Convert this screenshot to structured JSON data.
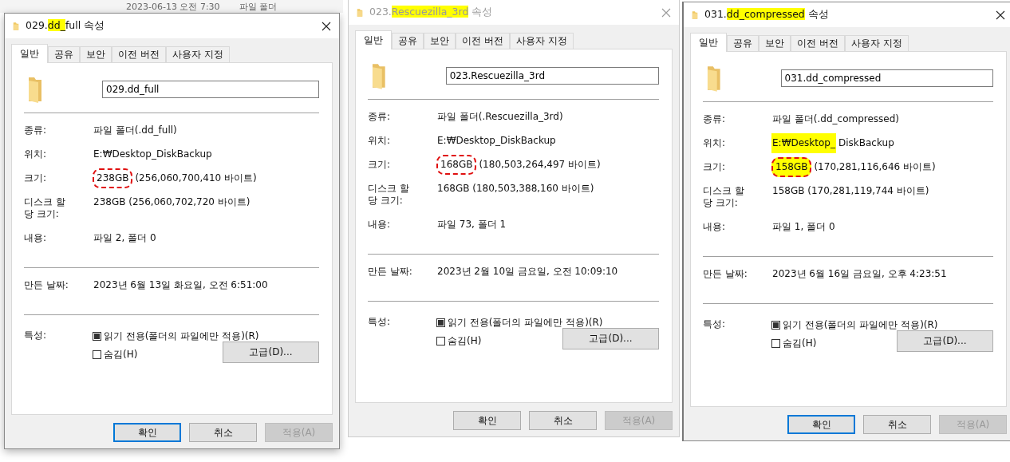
{
  "background": {
    "texts": [
      "2023-06-13 오전 7:30",
      "파일 폴더"
    ]
  },
  "dialogs": [
    {
      "active": true,
      "title_parts": [
        {
          "text": "029.",
          "highlight": false
        },
        {
          "text": "dd_",
          "highlight": true
        },
        {
          "text": "full 속성",
          "highlight": false
        }
      ],
      "tabs": [
        {
          "label": "일반",
          "selected": true
        },
        {
          "label": "공유",
          "selected": false
        },
        {
          "label": "보안",
          "selected": false
        },
        {
          "label": "이전 버전",
          "selected": false
        },
        {
          "label": "사용자 지정",
          "selected": false
        }
      ],
      "name": "029.dd_full",
      "sections": [
        [
          {
            "label": "종류:",
            "parts": [
              {
                "text": "파일 폴더(.dd_full)",
                "highlight": false,
                "circled": false
              }
            ]
          },
          {
            "label": "위치:",
            "parts": [
              {
                "text": "E:₩Desktop_DiskBackup",
                "highlight": false,
                "circled": false
              }
            ]
          },
          {
            "label": "크기:",
            "parts": [
              {
                "text": "238GB",
                "highlight": false,
                "circled": true
              },
              {
                "text": "(256,060,700,410 바이트)",
                "highlight": false,
                "circled": false
              }
            ]
          },
          {
            "label": "디스크 할당 크기:",
            "parts": [
              {
                "text": "238GB (256,060,702,720 바이트)",
                "highlight": false,
                "circled": false
              }
            ]
          },
          {
            "label": "내용:",
            "parts": [
              {
                "text": "파일 2, 폴더 0",
                "highlight": false,
                "circled": false
              }
            ]
          }
        ],
        [
          {
            "label": "만든 날짜:",
            "parts": [
              {
                "text": "2023년 6월 13일 화요일, 오전 6:51:00",
                "highlight": false,
                "circled": false
              }
            ]
          }
        ]
      ],
      "attributes_label": "특성:",
      "attributes": [
        {
          "label": "읽기 전용(폴더의 파일에만 적용)(R)",
          "checked": false,
          "indeterminate": true
        },
        {
          "label": "숨김(H)",
          "checked": false,
          "indeterminate": false
        }
      ],
      "advanced": "고급(D)...",
      "buttons": [
        {
          "label": "확인",
          "focused": true,
          "disabled": false
        },
        {
          "label": "취소",
          "focused": false,
          "disabled": false
        },
        {
          "label": "적용(A)",
          "focused": false,
          "disabled": true
        }
      ]
    },
    {
      "active": false,
      "title_parts": [
        {
          "text": "023.",
          "highlight": false
        },
        {
          "text": "Rescuezilla_3rd",
          "highlight": true
        },
        {
          "text": " 속성",
          "highlight": false
        }
      ],
      "tabs": [
        {
          "label": "일반",
          "selected": true
        },
        {
          "label": "공유",
          "selected": false
        },
        {
          "label": "보안",
          "selected": false
        },
        {
          "label": "이전 버전",
          "selected": false
        },
        {
          "label": "사용자 지정",
          "selected": false
        }
      ],
      "name": "023.Rescuezilla_3rd",
      "sections": [
        [
          {
            "label": "종류:",
            "parts": [
              {
                "text": "파일 폴더(.Rescuezilla_3rd)",
                "highlight": false,
                "circled": false
              }
            ]
          },
          {
            "label": "위치:",
            "parts": [
              {
                "text": "E:₩Desktop_DiskBackup",
                "highlight": false,
                "circled": false
              }
            ]
          },
          {
            "label": "크기:",
            "parts": [
              {
                "text": "168GB",
                "highlight": false,
                "circled": true
              },
              {
                "text": "(180,503,264,497 바이트)",
                "highlight": false,
                "circled": false
              }
            ]
          },
          {
            "label": "디스크 할당 크기:",
            "parts": [
              {
                "text": "168GB (180,503,388,160 바이트)",
                "highlight": false,
                "circled": false
              }
            ]
          },
          {
            "label": "내용:",
            "parts": [
              {
                "text": "파일 73, 폴더 1",
                "highlight": false,
                "circled": false
              }
            ]
          }
        ],
        [
          {
            "label": "만든 날짜:",
            "parts": [
              {
                "text": "2023년 2월 10일 금요일, 오전 10:09:10",
                "highlight": false,
                "circled": false
              }
            ]
          }
        ]
      ],
      "attributes_label": "특성:",
      "attributes": [
        {
          "label": "읽기 전용(폴더의 파일에만 적용)(R)",
          "checked": false,
          "indeterminate": true
        },
        {
          "label": "숨김(H)",
          "checked": false,
          "indeterminate": false
        }
      ],
      "advanced": "고급(D)...",
      "buttons": [
        {
          "label": "확인",
          "focused": false,
          "disabled": false
        },
        {
          "label": "취소",
          "focused": false,
          "disabled": false
        },
        {
          "label": "적용(A)",
          "focused": false,
          "disabled": true
        }
      ]
    },
    {
      "active": true,
      "title_parts": [
        {
          "text": "031.",
          "highlight": false
        },
        {
          "text": "dd_compressed",
          "highlight": true
        },
        {
          "text": " 속성",
          "highlight": false
        }
      ],
      "tabs": [
        {
          "label": "일반",
          "selected": true
        },
        {
          "label": "공유",
          "selected": false
        },
        {
          "label": "보안",
          "selected": false
        },
        {
          "label": "이전 버전",
          "selected": false
        },
        {
          "label": "사용자 지정",
          "selected": false
        }
      ],
      "name": "031.dd_compressed",
      "sections": [
        [
          {
            "label": "종류:",
            "parts": [
              {
                "text": "파일 폴더(.dd_compressed)",
                "highlight": false,
                "circled": false
              }
            ]
          },
          {
            "label": "위치:",
            "parts": [
              {
                "text": "E:₩Desktop_",
                "highlight": true,
                "circled": false
              },
              {
                "text": "DiskBackup",
                "highlight": false,
                "circled": false
              }
            ]
          },
          {
            "label": "크기:",
            "parts": [
              {
                "text": "158GB",
                "highlight": true,
                "circled": true
              },
              {
                "text": "(170,281,116,646 바이트)",
                "highlight": false,
                "circled": false
              }
            ]
          },
          {
            "label": "디스크 할당 크기:",
            "parts": [
              {
                "text": "158GB (170,281,119,744 바이트)",
                "highlight": false,
                "circled": false
              }
            ]
          },
          {
            "label": "내용:",
            "parts": [
              {
                "text": "파일 1, 폴더 0",
                "highlight": false,
                "circled": false
              }
            ]
          }
        ],
        [
          {
            "label": "만든 날짜:",
            "parts": [
              {
                "text": "2023년 6월 16일 금요일, 오후 4:23:51",
                "highlight": false,
                "circled": false
              }
            ]
          }
        ]
      ],
      "attributes_label": "특성:",
      "attributes": [
        {
          "label": "읽기 전용(폴더의 파일에만 적용)(R)",
          "checked": false,
          "indeterminate": true
        },
        {
          "label": "숨김(H)",
          "checked": false,
          "indeterminate": false
        }
      ],
      "advanced": "고급(D)...",
      "buttons": [
        {
          "label": "확인",
          "focused": true,
          "disabled": false
        },
        {
          "label": "취소",
          "focused": false,
          "disabled": false
        },
        {
          "label": "적용(A)",
          "focused": false,
          "disabled": true
        }
      ]
    }
  ]
}
